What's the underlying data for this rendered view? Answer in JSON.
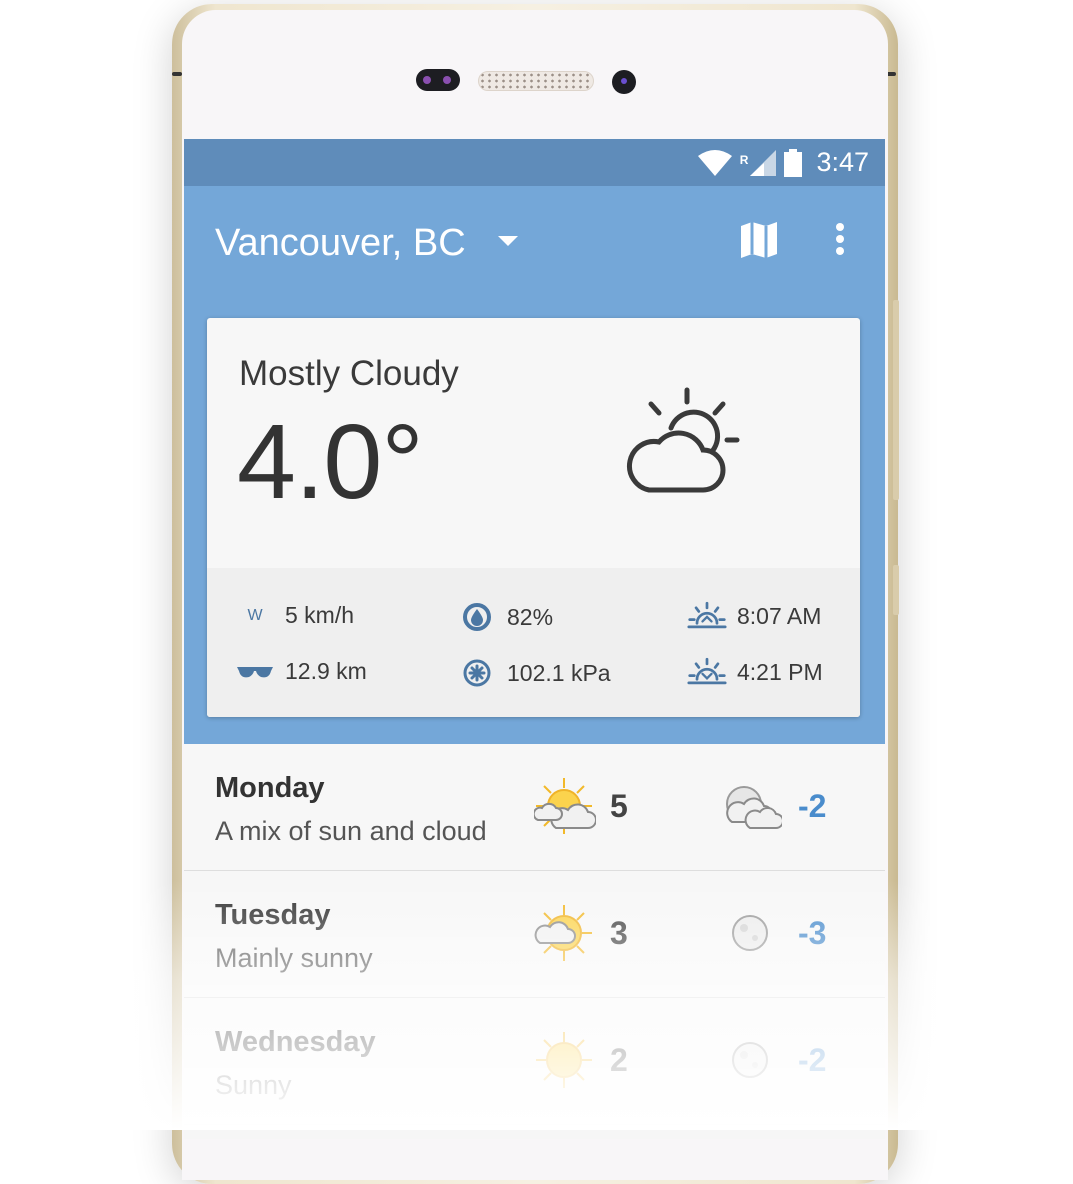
{
  "status_bar": {
    "time": "3:47",
    "roaming_label": "R",
    "icons": [
      "wifi-icon",
      "signal-icon",
      "battery-icon"
    ]
  },
  "app_bar": {
    "location": "Vancouver, BC",
    "icons": [
      "dropdown-arrow-icon",
      "map-icon",
      "more-vert-icon"
    ]
  },
  "current": {
    "condition": "Mostly Cloudy",
    "temperature": "4.0°",
    "icon": "partly-cloudy-icon",
    "details": {
      "wind": {
        "icon_label": "W",
        "value": "5 km/h"
      },
      "humidity": {
        "icon": "humidity-icon",
        "value": "82%"
      },
      "sunrise": {
        "icon": "sunrise-icon",
        "value": "8:07 AM"
      },
      "visibility": {
        "icon": "visibility-icon",
        "value": "12.9 km"
      },
      "pressure": {
        "icon": "pressure-icon",
        "value": "102.1 kPa"
      },
      "sunset": {
        "icon": "sunset-icon",
        "value": "4:21 PM"
      }
    }
  },
  "forecast": [
    {
      "day": "Monday",
      "description": "A mix of sun and cloud",
      "high": "5",
      "low": "-2",
      "high_icon": "sun-cloud-icon",
      "low_icon": "moon-cloud-icon"
    },
    {
      "day": "Tuesday",
      "description": "Mainly sunny",
      "high": "3",
      "low": "-3",
      "high_icon": "sun-small-cloud-icon",
      "low_icon": "moon-icon"
    },
    {
      "day": "Wednesday",
      "description": "Sunny",
      "high": "2",
      "low": "-2",
      "high_icon": "sun-icon",
      "low_icon": "moon-icon"
    }
  ],
  "colors": {
    "status_bar": "#5f8cba",
    "app_bar": "#74a7d8",
    "low_temp": "#4a8ccc",
    "detail_icons": "#4b77a3"
  }
}
